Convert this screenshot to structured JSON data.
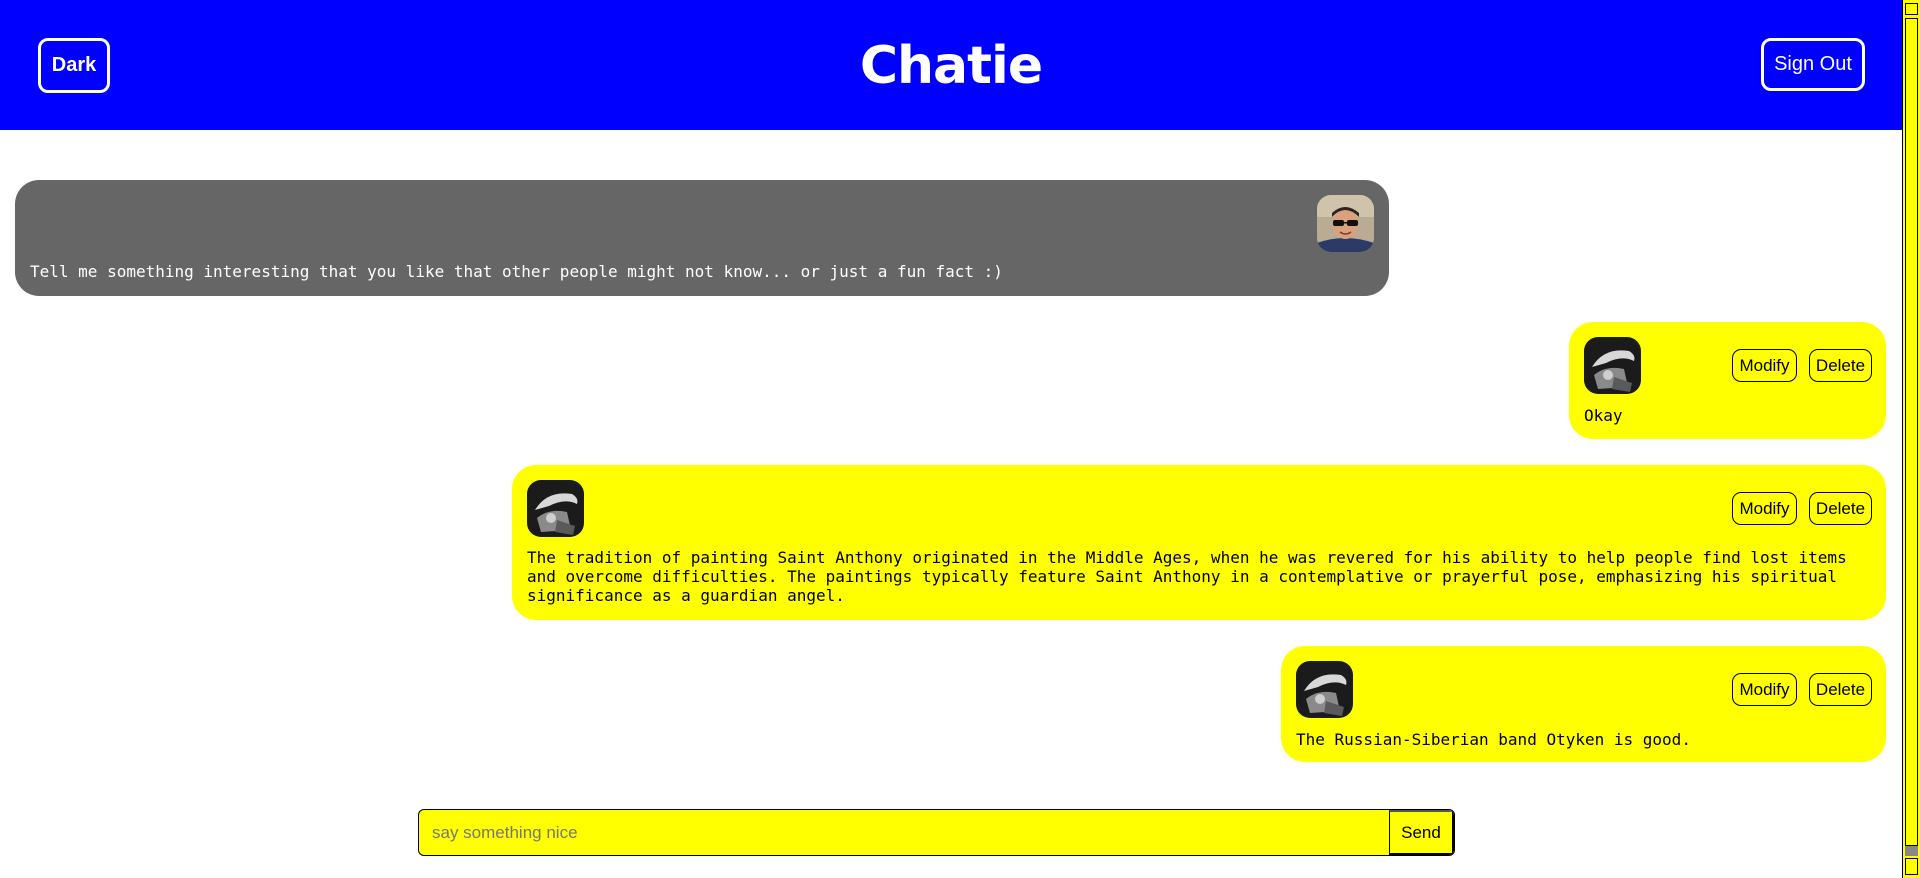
{
  "header": {
    "theme_toggle_label": "Dark",
    "app_title": "Chatie",
    "sign_out_label": "Sign Out"
  },
  "messages": [
    {
      "author": "other",
      "avatar_icon": "user-photo-sunglasses",
      "text": "Tell me something interesting that you like that other people might not know... or just a fun fact :)"
    },
    {
      "author": "me",
      "avatar_icon": "user-photo-monochrome",
      "text": "Okay",
      "modify_label": "Modify",
      "delete_label": "Delete"
    },
    {
      "author": "me",
      "avatar_icon": "user-photo-monochrome",
      "text": "The tradition of painting Saint Anthony originated in the Middle Ages, when he was revered for his ability to help people find lost items and overcome difficulties. The paintings typically feature Saint Anthony in a contemplative or prayerful pose, emphasizing his spiritual significance as a guardian angel.",
      "modify_label": "Modify",
      "delete_label": "Delete"
    },
    {
      "author": "me",
      "avatar_icon": "user-photo-monochrome",
      "text": "The Russian-Siberian band Otyken is good.",
      "modify_label": "Modify",
      "delete_label": "Delete"
    }
  ],
  "composer": {
    "placeholder": "say something nice",
    "value": "",
    "send_label": "Send"
  },
  "colors": {
    "header_bg": "#0000ff",
    "my_bubble": "#ffff00",
    "other_bubble": "#666666"
  }
}
